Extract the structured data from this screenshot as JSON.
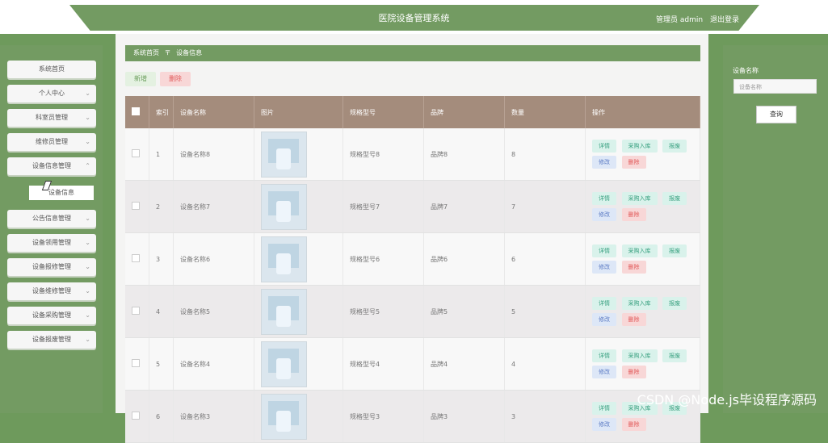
{
  "header": {
    "title": "医院设备管理系统",
    "user_text": "管理员 admin",
    "logout_text": "退出登录"
  },
  "sidebar": {
    "items": [
      {
        "label": "系统首页",
        "has_chevron": false
      },
      {
        "label": "个人中心",
        "has_chevron": true
      },
      {
        "label": "科室员管理",
        "has_chevron": true
      },
      {
        "label": "维修员管理",
        "has_chevron": true
      },
      {
        "label": "设备信息管理",
        "has_chevron": true
      },
      {
        "label": "公告信息管理",
        "has_chevron": true
      },
      {
        "label": "设备领用管理",
        "has_chevron": true
      },
      {
        "label": "设备报修管理",
        "has_chevron": true
      },
      {
        "label": "设备维修管理",
        "has_chevron": true
      },
      {
        "label": "设备采购管理",
        "has_chevron": true
      },
      {
        "label": "设备报废管理",
        "has_chevron": true
      }
    ],
    "submenu_label": "设备信息"
  },
  "breadcrumb": {
    "home": "系统首页",
    "separator": "〒",
    "current": "设备信息"
  },
  "toolbar": {
    "add": "新增",
    "delete": "删除"
  },
  "table": {
    "headers": [
      "索引",
      "设备名称",
      "图片",
      "规格型号",
      "品牌",
      "数量",
      "操作"
    ],
    "rows": [
      {
        "index": "1",
        "name": "设备名称8",
        "spec": "规格型号8",
        "brand": "品牌8",
        "qty": "8"
      },
      {
        "index": "2",
        "name": "设备名称7",
        "spec": "规格型号7",
        "brand": "品牌7",
        "qty": "7"
      },
      {
        "index": "3",
        "name": "设备名称6",
        "spec": "规格型号6",
        "brand": "品牌6",
        "qty": "6"
      },
      {
        "index": "4",
        "name": "设备名称5",
        "spec": "规格型号5",
        "brand": "品牌5",
        "qty": "5"
      },
      {
        "index": "5",
        "name": "设备名称4",
        "spec": "规格型号4",
        "brand": "品牌4",
        "qty": "4"
      },
      {
        "index": "6",
        "name": "设备名称3",
        "spec": "规格型号3",
        "brand": "品牌3",
        "qty": "3"
      }
    ],
    "ops": {
      "detail": "详情",
      "purchase": "采购入库",
      "scrap": "报废",
      "edit": "修改",
      "delete": "删除"
    }
  },
  "search": {
    "label": "设备名称",
    "placeholder": "设备名称",
    "button": "查询"
  },
  "watermark": "CSDN @Node.js毕设程序源码"
}
